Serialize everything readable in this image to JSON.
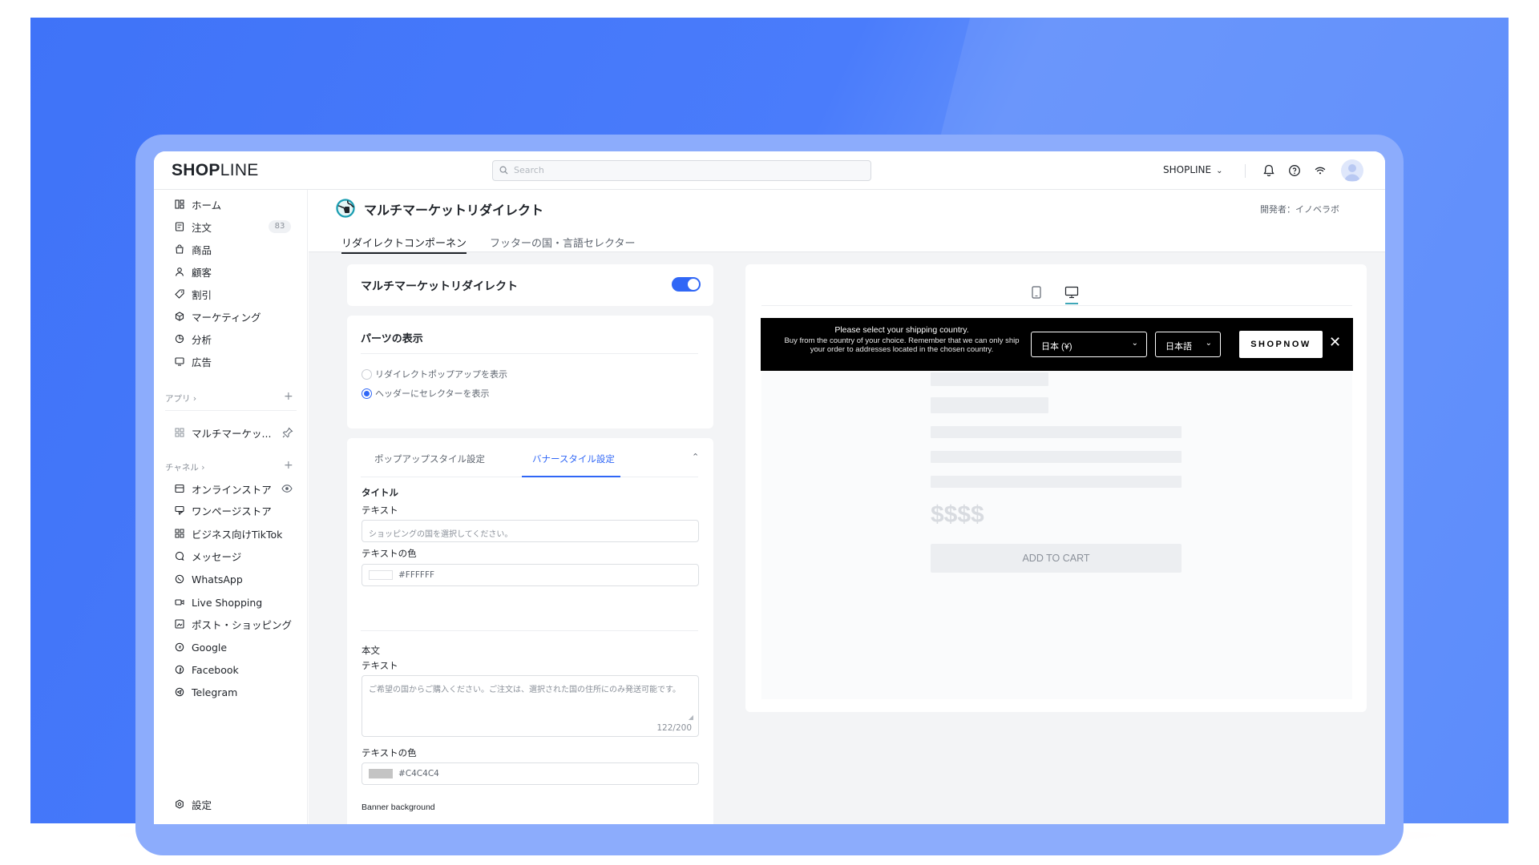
{
  "topbar": {
    "logo_bold": "SHOP",
    "logo_rest": "LINE",
    "search_placeholder": "Search",
    "store_name": "SHOPLINE"
  },
  "sidebar": {
    "items": [
      {
        "label": "ホーム",
        "icon": "dashboard-icon"
      },
      {
        "label": "注文",
        "icon": "order-icon",
        "badge": "83"
      },
      {
        "label": "商品",
        "icon": "bag-icon"
      },
      {
        "label": "顧客",
        "icon": "user-icon"
      },
      {
        "label": "割引",
        "icon": "tag-icon"
      },
      {
        "label": "マーケティング",
        "icon": "box-icon"
      },
      {
        "label": "分析",
        "icon": "pie-icon"
      },
      {
        "label": "広告",
        "icon": "ad-icon"
      }
    ],
    "apps_section": "アプリ ›",
    "app_item": "マルチマーケッ...",
    "channels_section": "チャネル ›",
    "channels": [
      {
        "label": "オンラインストア",
        "icon": "store-icon"
      },
      {
        "label": "ワンページストア",
        "icon": "onepage-icon"
      },
      {
        "label": "ビジネス向けTikTok",
        "icon": "tiktok-icon"
      },
      {
        "label": "メッセージ",
        "icon": "message-icon"
      },
      {
        "label": "WhatsApp",
        "icon": "whatsapp-icon"
      },
      {
        "label": "Live Shopping",
        "icon": "video-icon"
      },
      {
        "label": "ポスト・ショッピング",
        "icon": "post-icon"
      },
      {
        "label": "Google",
        "icon": "google-icon"
      },
      {
        "label": "Facebook",
        "icon": "facebook-icon"
      },
      {
        "label": "Telegram",
        "icon": "telegram-icon"
      }
    ],
    "settings": "設定"
  },
  "page": {
    "title": "マルチマーケットリダイレクト",
    "developer": "開発者：イノベラボ",
    "tabs": [
      "リダイレクトコンポーネン",
      "フッターの国・言語セレクター"
    ]
  },
  "toggle_card": {
    "title": "マルチマーケットリダイレクト",
    "enabled": true
  },
  "parts_card": {
    "title": "パーツの表示",
    "options": [
      "リダイレクトポップアップを表示",
      "ヘッダーにセレクターを表示"
    ],
    "selected": 1
  },
  "style_card": {
    "tabs": [
      "ポップアップスタイル設定",
      "バナースタイル設定"
    ],
    "active_tab": 1,
    "title_section": "タイトル",
    "text_label": "テキスト",
    "title_placeholder": "ショッピングの国を選択してください。",
    "color_label": "テキストの色",
    "title_color": "#FFFFFF",
    "body_section": "本文",
    "body_text": "ご希望の国からご購入ください。ご注文は、選択された国の住所にのみ発送可能です。",
    "body_count": "122/200",
    "body_color": "#C4C4C4",
    "banner_bg_label": "Banner background"
  },
  "preview": {
    "banner": {
      "title": "Please select your shipping country.",
      "body": "Buy from the country of your choice. Remember that we can only ship your order to addresses located in the chosen country.",
      "country": "日本 (¥)",
      "language": "日本語",
      "button": "SHOPNOW",
      "close": "✕"
    },
    "price": "$$$$",
    "add_to_cart": "ADD TO CART"
  },
  "colors": {
    "accent": "#3067F6",
    "hero_bg": "#4A7CFB",
    "banner_bg": "#000000"
  }
}
